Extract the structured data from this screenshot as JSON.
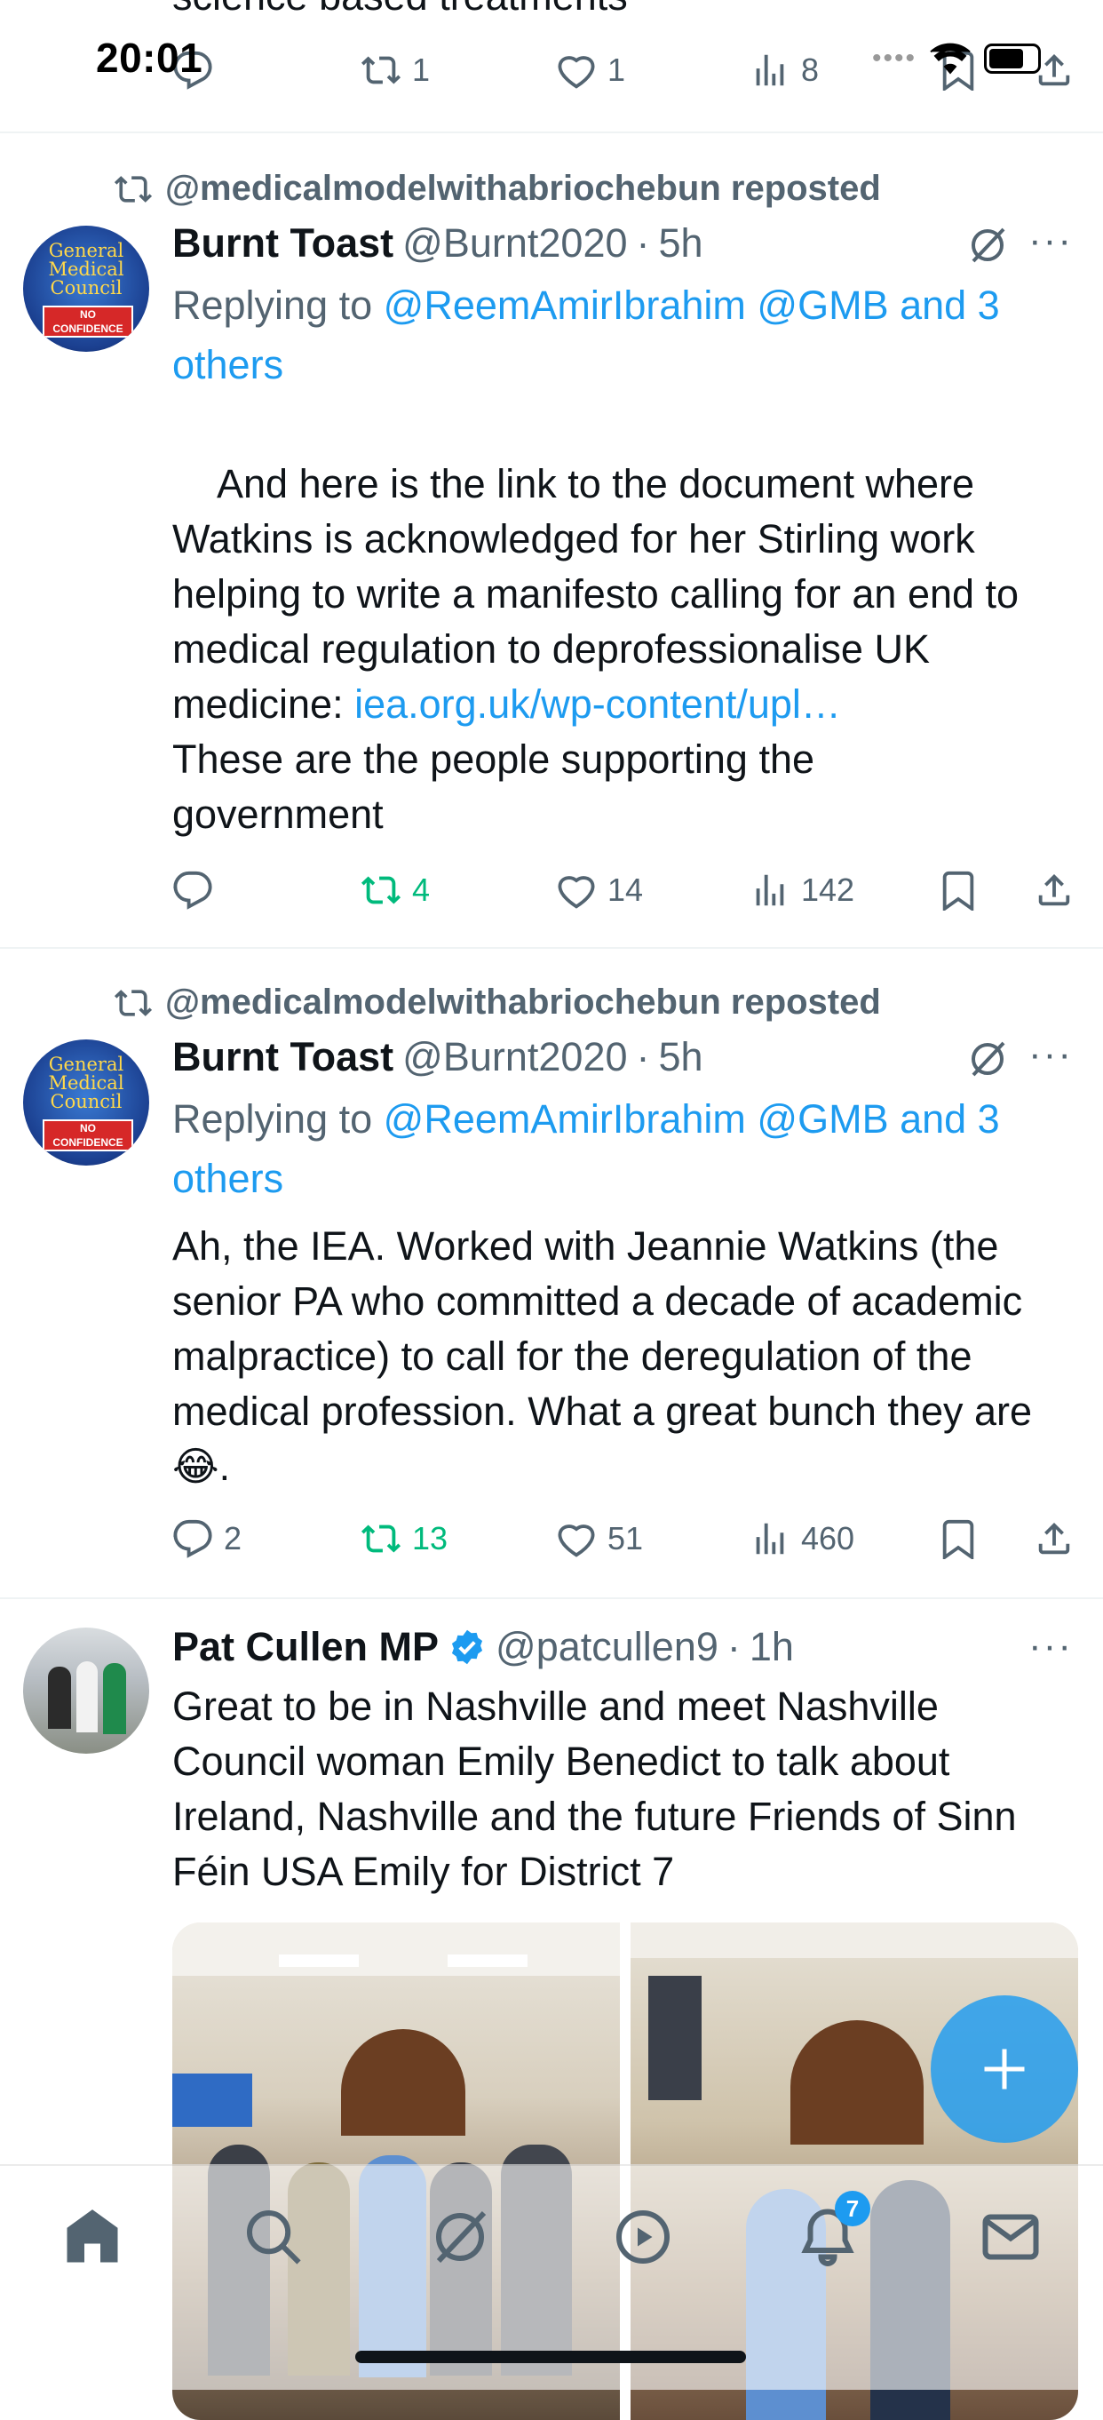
{
  "status_bar": {
    "time": "20:01"
  },
  "top_post_fragment": {
    "text": "science based treatments",
    "retweets": "1",
    "likes": "1",
    "views": "8"
  },
  "posts": [
    {
      "repost_by": "@medicalmodelwithabriochebun reposted",
      "name": "Burnt Toast",
      "handle": "@Burnt2020",
      "dot": "·",
      "time": "5h",
      "replying_label": "Replying to",
      "replying_targets": "@ReemAmirIbrahim @GMB and 3 others",
      "body_line1": "And here is the link to the document where Watkins is acknowledged for her Stirling work helping to write a manifesto calling for an end to medical regulation to deprofessionalise UK medicine: ",
      "body_link": "iea.org.uk/wp-content/upl…",
      "body_line2": "These are the people supporting the government",
      "replies": "",
      "retweets": "4",
      "likes": "14",
      "views": "142"
    },
    {
      "repost_by": "@medicalmodelwithabriochebun reposted",
      "name": "Burnt Toast",
      "handle": "@Burnt2020",
      "dot": "·",
      "time": "5h",
      "replying_label": "Replying to",
      "replying_targets": "@ReemAmirIbrahim @GMB and 3 others",
      "body": "Ah, the IEA. Worked with Jeannie Watkins (the senior PA who committed a decade of academic malpractice) to call for the deregulation of the medical profession. What a great bunch they are 😂.",
      "replies": "2",
      "retweets": "13",
      "likes": "51",
      "views": "460"
    },
    {
      "name": "Pat Cullen MP",
      "handle": "@patcullen9",
      "dot": "·",
      "time": "1h",
      "body": "Great to be in Nashville and meet Nashville Council woman Emily Benedict to talk about Ireland, Nashville and the future Friends of Sinn Féin USA Emily for District 7"
    }
  ],
  "avatar_text": {
    "line1": "General",
    "line2": "Medical",
    "line3": "Council",
    "badge": "NO CONFIDENCE"
  },
  "tabbar": {
    "items": [
      "home-icon",
      "search-icon",
      "grok-icon",
      "video-icon",
      "notifications-icon",
      "messages-icon"
    ],
    "notification_badge": "7"
  },
  "colors": {
    "accent": "#1d9bf0",
    "retweet_active": "#00ba7c",
    "muted": "#536471"
  }
}
